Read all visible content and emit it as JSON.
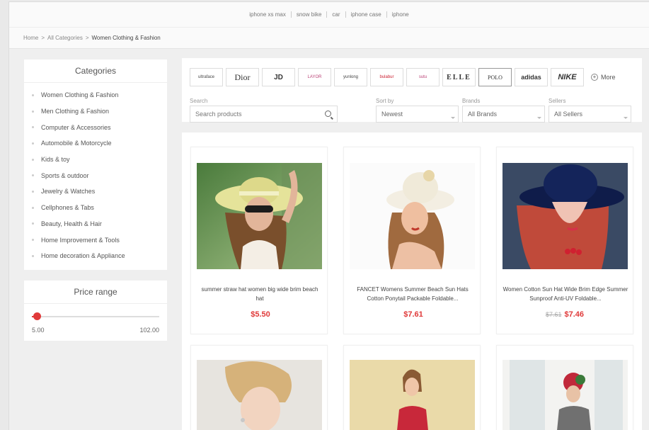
{
  "top_keywords": [
    "iphone xs max",
    "snow bike",
    "car",
    "iphone case",
    "iphone"
  ],
  "breadcrumb": {
    "home": "Home",
    "sep1": ">",
    "all": "All Categories",
    "sep2": ">",
    "current": "Women Clothing & Fashion"
  },
  "categories": {
    "title": "Categories",
    "items": [
      "Women Clothing & Fashion",
      "Men Clothing & Fashion",
      "Computer & Accessories",
      "Automobile & Motorcycle",
      "Kids & toy",
      "Sports & outdoor",
      "Jewelry & Watches",
      "Cellphones & Tabs",
      "Beauty, Health & Hair",
      "Home Improvement & Tools",
      "Home decoration & Appliance"
    ]
  },
  "price_range": {
    "title": "Price range",
    "min": "5.00",
    "max": "102.00",
    "position": 0.02,
    "accent": "#e03a3a"
  },
  "brands": [
    "ultraface",
    "Dior",
    "JD",
    "LAYOR",
    "yunlong",
    "bulabur",
    "sutu",
    "ELLE",
    "POLO",
    "adidas",
    "NIKE"
  ],
  "more_label": "More",
  "search": {
    "label": "Search",
    "placeholder": "Search products"
  },
  "sort": {
    "label": "Sort by",
    "value": "Newest"
  },
  "brands_filter": {
    "label": "Brands",
    "value": "All Brands"
  },
  "sellers_filter": {
    "label": "Sellers",
    "value": "All Sellers"
  },
  "products": [
    {
      "title": "summer straw hat women big wide brim beach hat",
      "price": "$5.50",
      "old_price": ""
    },
    {
      "title": "FANCET Womens Summer Beach Sun Hats Cotton Ponytail Packable Foldable...",
      "price": "$7.61",
      "old_price": ""
    },
    {
      "title": "Women Cotton Sun Hat Wide Brim Edge Summer Sunproof Anti-UV Foldable...",
      "price": "$7.46",
      "old_price": "$7.61"
    },
    {
      "title": "",
      "price": "",
      "old_price": ""
    },
    {
      "title": "",
      "price": "",
      "old_price": ""
    },
    {
      "title": "",
      "price": "",
      "old_price": ""
    }
  ]
}
